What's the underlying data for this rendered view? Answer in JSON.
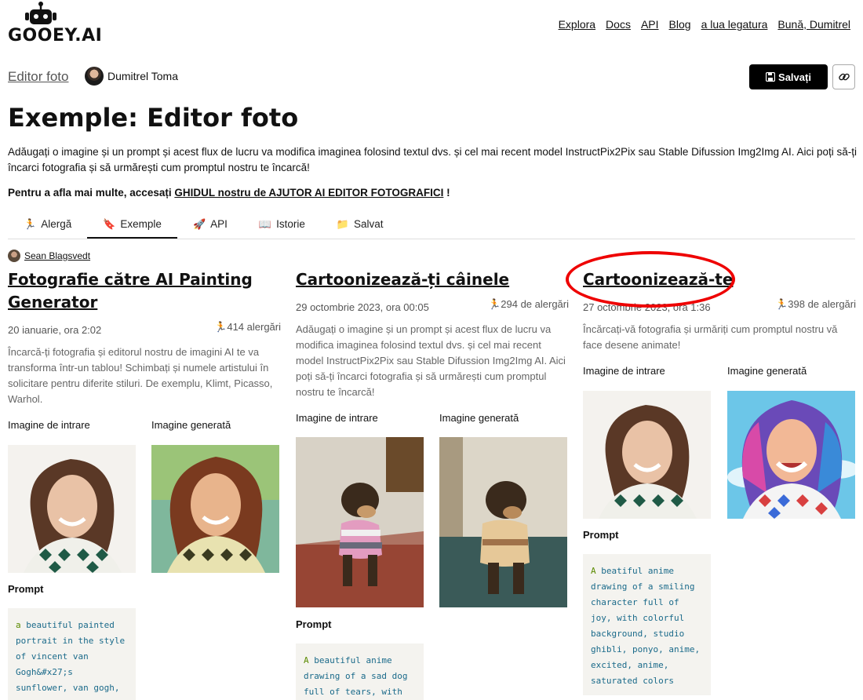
{
  "brand": {
    "logo_text": "GOOEY.AI"
  },
  "topnav": [
    "Explora",
    "Docs",
    "API",
    "Blog",
    "a lua legatura",
    "Bună, Dumitrel"
  ],
  "page": {
    "breadcrumb": "Editor foto",
    "author": "Dumitrel Toma",
    "save_label": "Salvați",
    "title": "Exemple: Editor foto",
    "description": "Adăugați o imagine și un prompt și acest flux de lucru va modifica imaginea folosind textul dvs. și cel mai recent model InstructPix2Pix sau Stable Difussion Img2Img AI. Aici poți să-ți încarci fotografia și să urmărești cum promptul nostru te încarcă!",
    "help_prefix": "Pentru a afla mai multe, accesați ",
    "help_link": "GHIDUL nostru de AJUTOR AI EDITOR FOTOGRAFICI",
    "help_suffix": " !"
  },
  "tabs": [
    {
      "icon": "🏃",
      "label": "Alergă"
    },
    {
      "icon": "🔖",
      "label": "Exemple"
    },
    {
      "icon": "🚀",
      "label": "API"
    },
    {
      "icon": "📖",
      "label": "Istorie"
    },
    {
      "icon": "📁",
      "label": "Salvat"
    }
  ],
  "contributor": "Sean Blagsvedt",
  "labels": {
    "input": "Imagine de intrare",
    "output": "Imagine generată",
    "prompt": "Prompt"
  },
  "cards": [
    {
      "title": "Fotografie către AI Painting Generator",
      "date": "20 ianuarie, ora 2:02",
      "runs": "414 alergări",
      "description": "Încarcă-ți fotografia și editorul nostru de imagini AI te va transforma într-un tablou! Schimbați și numele artistului în solicitare pentru diferite stiluri. De exemplu, Klimt, Picasso, Warhol.",
      "prompt_first": "a",
      "prompt_rest": " beautiful painted portrait in the style of vincent van Gogh&#x27;s sunflower, van gogh,"
    },
    {
      "title": "Cartoonizează-ți câinele",
      "date": "29 octombrie 2023, ora 00:05",
      "runs": "294 de alergări",
      "description": "Adăugați o imagine și un prompt și acest flux de lucru va modifica imaginea folosind textul dvs. și cel mai recent model InstructPix2Pix sau Stable Difussion Img2Img AI. Aici poți să-ți încarci fotografia și să urmărești cum promptul nostru te încarcă!",
      "prompt_first": "A",
      "prompt_rest": " beautiful anime drawing of a sad dog full of tears, with"
    },
    {
      "title": "Cartoonizează-te",
      "date": "27 octombrie 2023, ora 1:36",
      "runs": "398 de alergări",
      "description": "Încărcați-vă fotografia și urmăriți cum promptul nostru vă face desene animate!",
      "prompt_first": "A",
      "prompt_rest": " beatiful anime drawing of a smiling character full of joy, with colorful background, studio ghibli, ponyo, anime, excited, anime, saturated colors"
    }
  ]
}
